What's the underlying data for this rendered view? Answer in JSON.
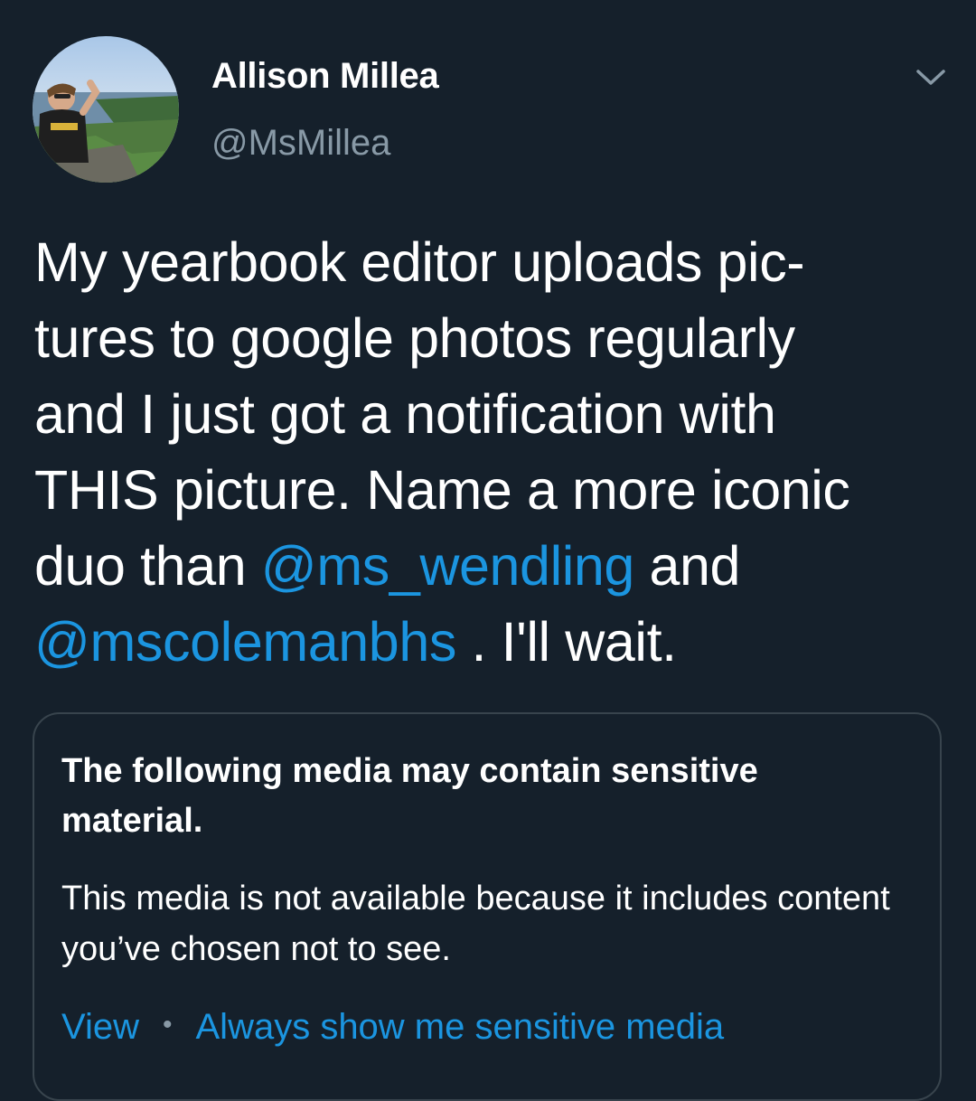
{
  "author": {
    "display_name": "Allison Millea",
    "handle": "@MsMillea",
    "avatar_icon": "profile-photo"
  },
  "menu": {
    "icon": "chevron-down-icon"
  },
  "tweet": {
    "line1": "My yearbook editor uploads pic-",
    "line2": "tures to google photos regularly",
    "line3": "and I just got a notification with",
    "line4": "THIS picture. Name a more iconic",
    "line5_before": "duo than ",
    "mention1": "@ms_wendling",
    "line5_after": " and",
    "mention2": "@mscolemanbhs",
    "line6_after": " . I'll wait."
  },
  "sensitive_notice": {
    "title": "The following media may contain sensitive material.",
    "body": "This media is not available because it includes content you’ve chosen not to see.",
    "view_label": "View",
    "separator": "•",
    "always_show_label": "Always show me sensitive media"
  },
  "colors": {
    "background": "#15202b",
    "text": "#ffffff",
    "secondary_text": "#8899a6",
    "link": "#1b95e0",
    "border": "#38444d"
  }
}
